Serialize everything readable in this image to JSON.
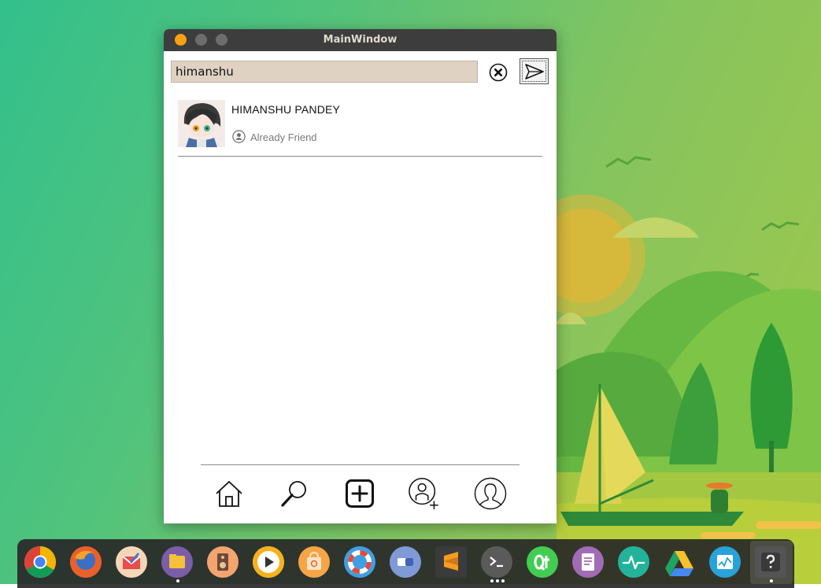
{
  "window": {
    "title": "MainWindow"
  },
  "search": {
    "value": "himanshu",
    "placeholder": ""
  },
  "results": [
    {
      "name": "HIMANSHU PANDEY",
      "status": "Already Friend"
    }
  ],
  "nav": [
    "home-icon",
    "search-icon",
    "add-post-icon",
    "add-friend-icon",
    "profile-icon"
  ],
  "dock": [
    "chrome",
    "firefox",
    "mail",
    "files",
    "music",
    "video-player",
    "software-center",
    "help",
    "toggle",
    "sublime-text",
    "terminal",
    "qt-creator",
    "text-editor",
    "system-monitor",
    "google-drive",
    "monitor",
    "unknown-app"
  ],
  "colors": {
    "titlebar": "#3d3d3d",
    "close": "#f7a20f",
    "search_bg": "#e0d2c3"
  }
}
